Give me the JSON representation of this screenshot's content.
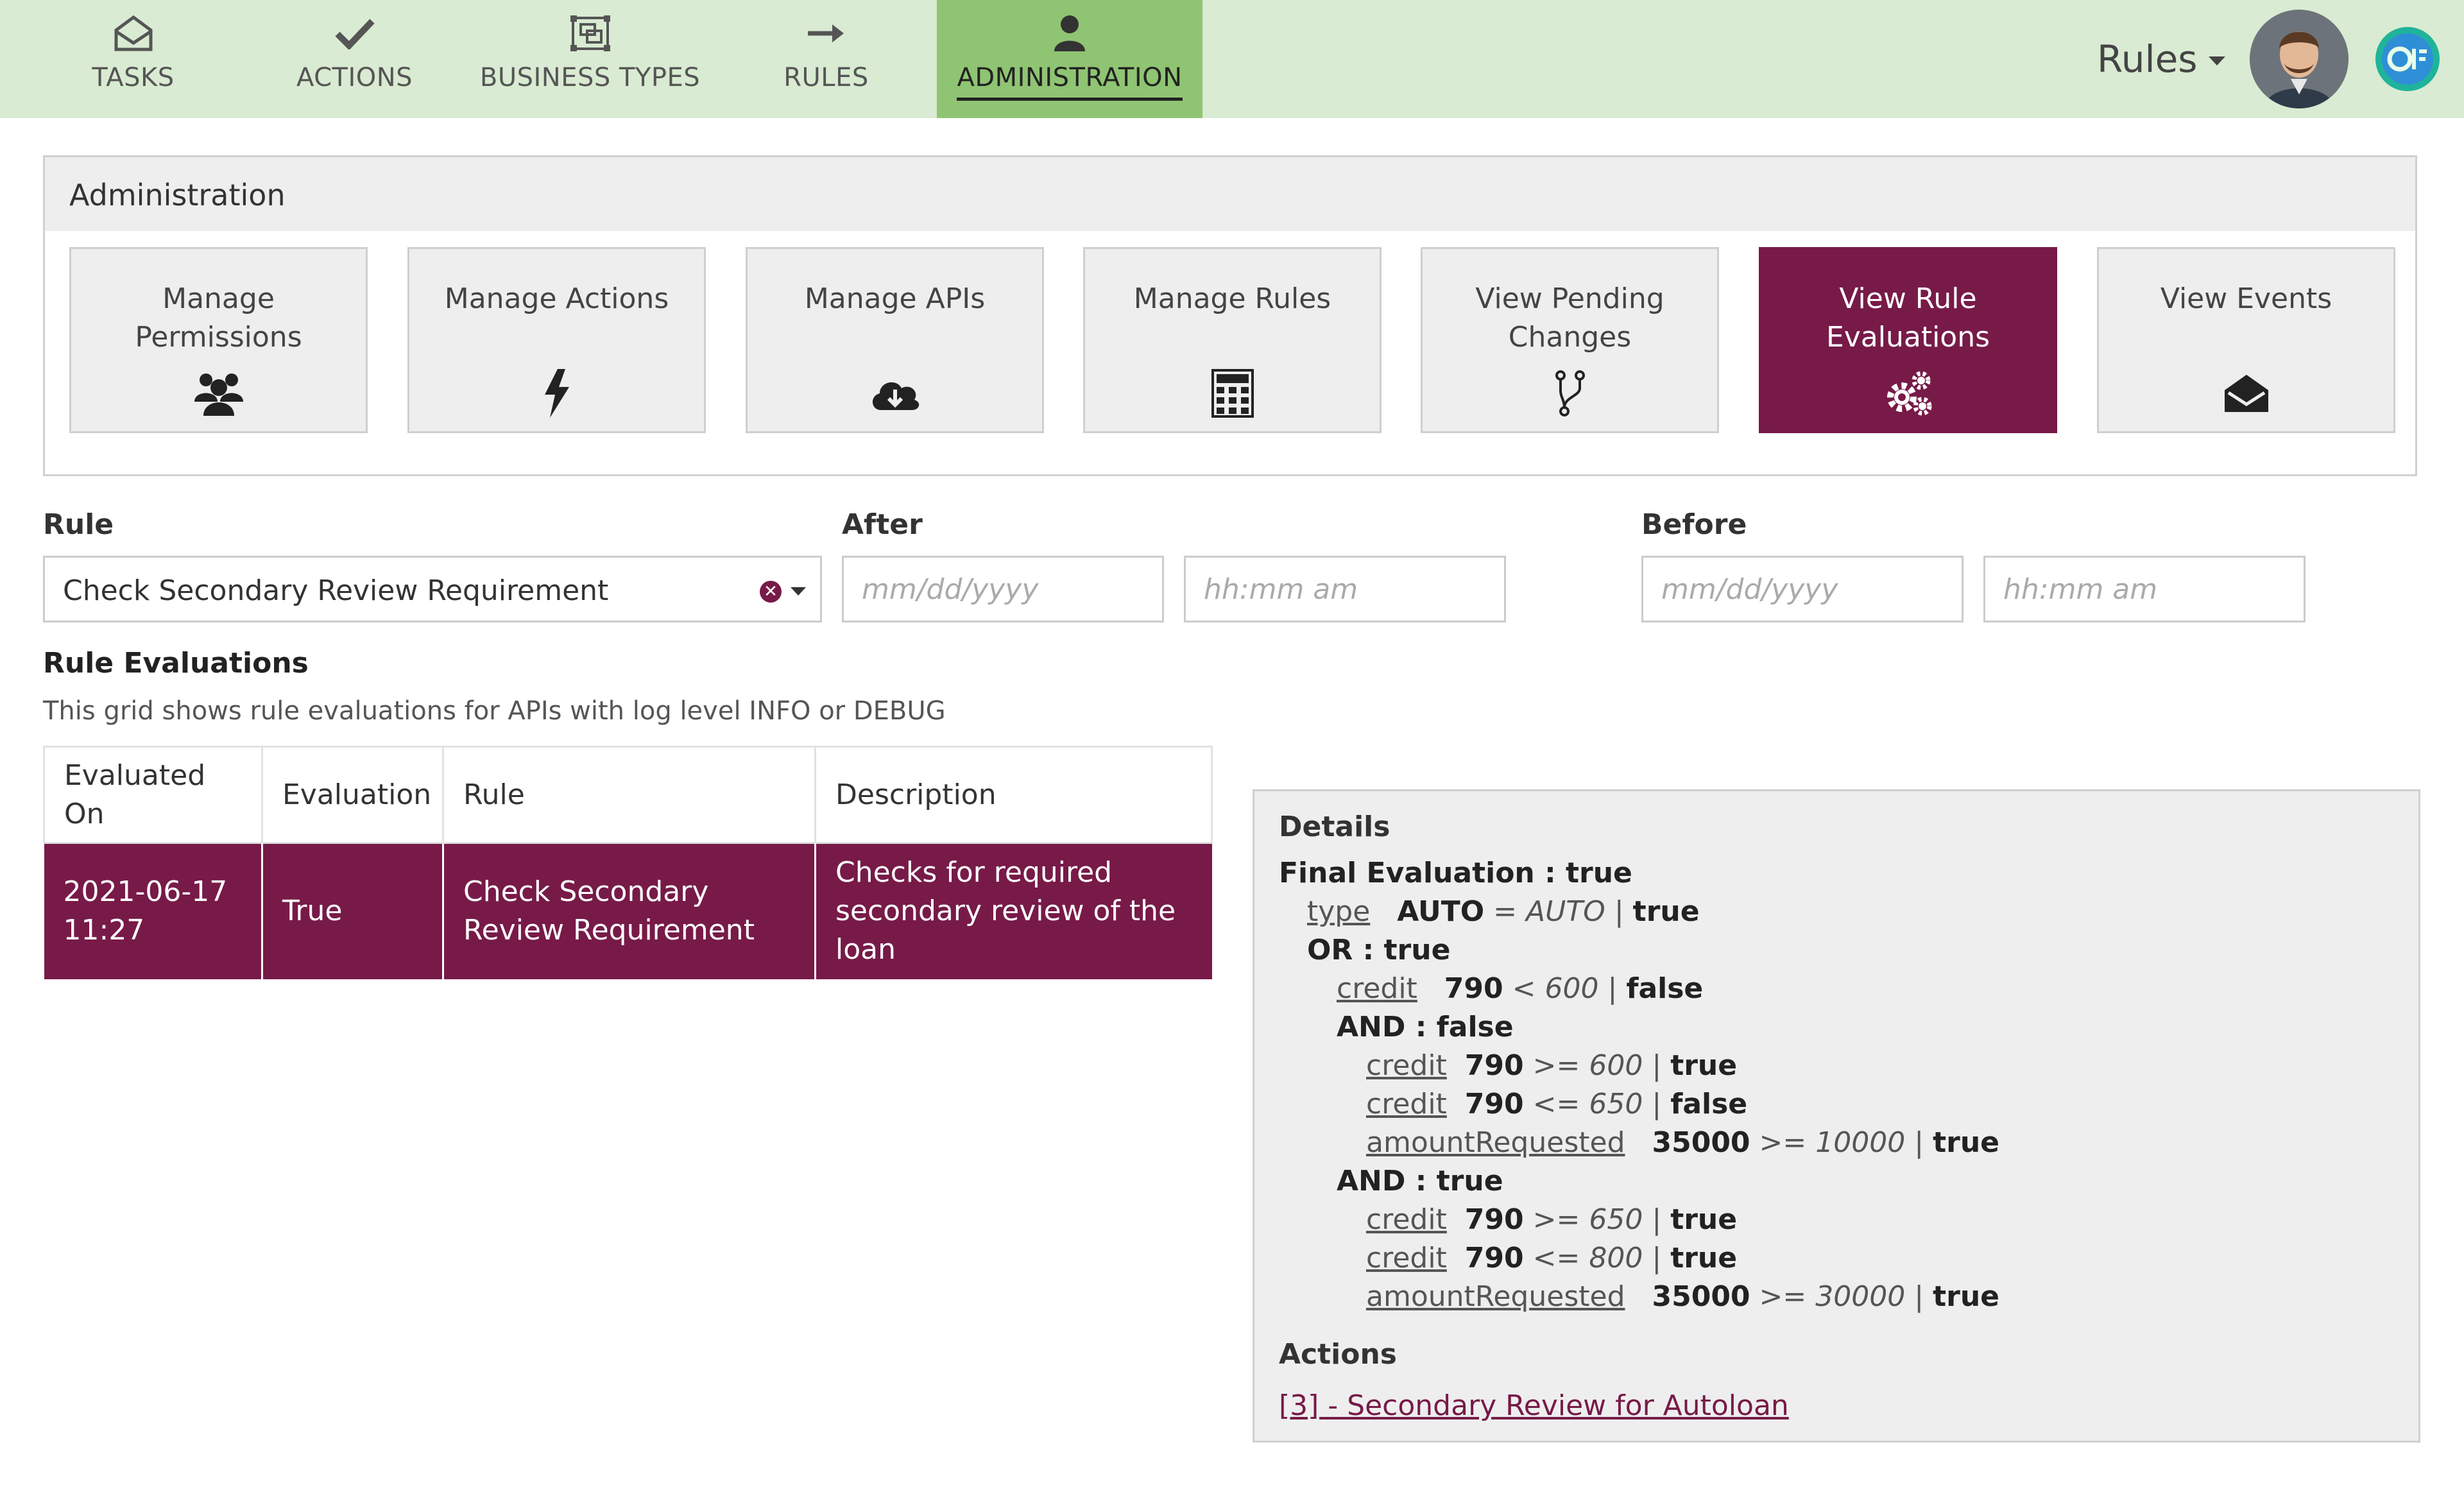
{
  "nav": {
    "items": [
      {
        "label": "TASKS",
        "icon": "envelope-open-icon"
      },
      {
        "label": "ACTIONS",
        "icon": "checkmark-icon"
      },
      {
        "label": "BUSINESS TYPES",
        "icon": "object-group-icon"
      },
      {
        "label": "RULES",
        "icon": "arrow-right-icon"
      },
      {
        "label": "ADMINISTRATION",
        "icon": "user-icon",
        "active": true
      }
    ],
    "rules_menu_label": "Rules"
  },
  "admin": {
    "title": "Administration",
    "tiles": [
      {
        "label": "Manage Permissions",
        "icon": "users-icon"
      },
      {
        "label": "Manage Actions",
        "icon": "bolt-icon"
      },
      {
        "label": "Manage APIs",
        "icon": "cloud-download-icon"
      },
      {
        "label": "Manage Rules",
        "icon": "calculator-icon"
      },
      {
        "label": "View Pending Changes",
        "icon": "code-fork-icon"
      },
      {
        "label": "View Rule Evaluations",
        "icon": "cogs-icon",
        "selected": true
      },
      {
        "label": "View Events",
        "icon": "envelope-open-icon"
      }
    ]
  },
  "filters": {
    "rule_label": "Rule",
    "rule_value": "Check Secondary Review Requirement",
    "after_label": "After",
    "before_label": "Before",
    "date_placeholder": "mm/dd/yyyy",
    "time_placeholder": "hh:mm am"
  },
  "evaluations": {
    "title": "Rule Evaluations",
    "description": "This grid shows rule evaluations for APIs with log level INFO or DEBUG",
    "columns": [
      "Evaluated On",
      "Evaluation",
      "Rule",
      "Description"
    ],
    "rows": [
      {
        "evaluated_on": "2021-06-17 11:27",
        "evaluation": "True",
        "rule": "Check Secondary Review Requirement",
        "description": "Checks for required secondary review of the loan"
      }
    ]
  },
  "details": {
    "title": "Details",
    "final_evaluation": "Final Evaluation : true",
    "lines": [
      {
        "indent": 1,
        "field": "type",
        "value": "AUTO",
        "op": "=",
        "compare": "AUTO",
        "result": "true"
      },
      {
        "indent": 1,
        "group": "OR : true"
      },
      {
        "indent": 2,
        "field": "credit",
        "value": "790",
        "op": "<",
        "compare": "600",
        "result": "false"
      },
      {
        "indent": 2,
        "group": "AND : false"
      },
      {
        "indent": 3,
        "field": "credit",
        "value": "790",
        "op": ">=",
        "compare": "600",
        "result": "true"
      },
      {
        "indent": 3,
        "field": "credit",
        "value": "790",
        "op": "<=",
        "compare": "650",
        "result": "false"
      },
      {
        "indent": 3,
        "field": "amountRequested",
        "value": "35000",
        "op": ">=",
        "compare": "10000",
        "result": "true"
      },
      {
        "indent": 2,
        "group": "AND : true"
      },
      {
        "indent": 3,
        "field": "credit",
        "value": "790",
        "op": ">=",
        "compare": "650",
        "result": "true"
      },
      {
        "indent": 3,
        "field": "credit",
        "value": "790",
        "op": "<=",
        "compare": "800",
        "result": "true"
      },
      {
        "indent": 3,
        "field": "amountRequested",
        "value": "35000",
        "op": ">=",
        "compare": "30000",
        "result": "true"
      }
    ],
    "actions_title": "Actions",
    "action_link": "[3] - Secondary Review for Autoloan"
  },
  "colors": {
    "nav_bg": "#d9ebd2",
    "nav_active": "#8fc473",
    "accent": "#771a48"
  }
}
